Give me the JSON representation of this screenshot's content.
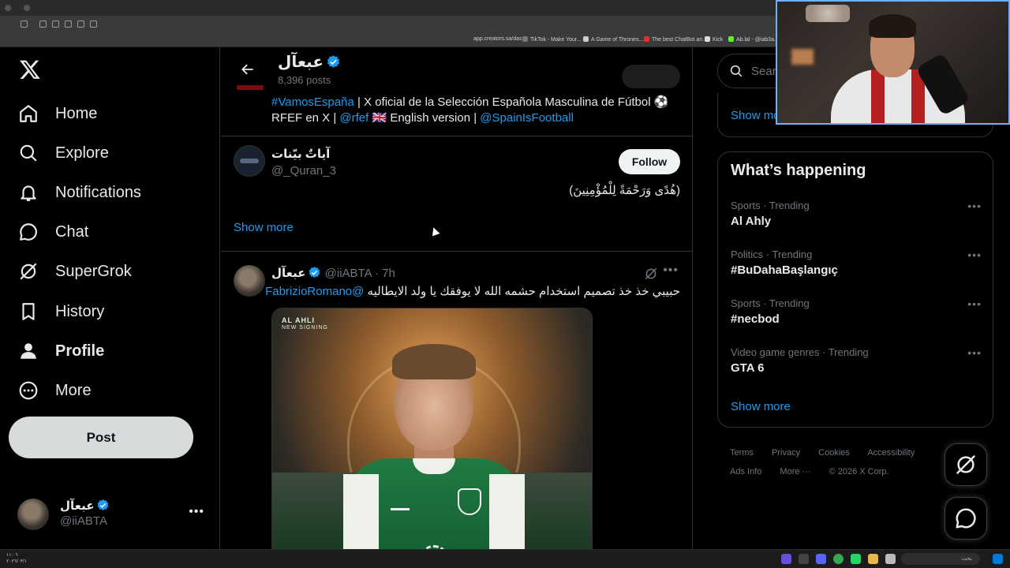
{
  "browser": {
    "bookmarks": [
      {
        "label": "app.creators.sa/das...",
        "color": "#9a9a9a"
      },
      {
        "label": "TikTok - Make Your...",
        "color": "#ffffff"
      },
      {
        "label": "A Game of Thrones...",
        "color": "#cccccc"
      },
      {
        "label": "The best ChatBot an...",
        "color": "#e03030"
      },
      {
        "label": "Kick",
        "color": "#ffffff"
      },
      {
        "label": "Ab.lal - @iab3a...",
        "color": "#53fc18"
      }
    ]
  },
  "nav": {
    "items": [
      {
        "label": "Home",
        "icon": "home-icon"
      },
      {
        "label": "Explore",
        "icon": "search-icon"
      },
      {
        "label": "Notifications",
        "icon": "bell-icon"
      },
      {
        "label": "Chat",
        "icon": "chat-icon"
      },
      {
        "label": "SuperGrok",
        "icon": "grok-icon"
      },
      {
        "label": "History",
        "icon": "bookmark-icon"
      },
      {
        "label": "Profile",
        "icon": "person-icon"
      },
      {
        "label": "More",
        "icon": "more-circle-icon"
      }
    ],
    "post_label": "Post",
    "account": {
      "name": "عبعآل",
      "handle": "@iiABTA"
    }
  },
  "profile": {
    "name": "عبعآل",
    "posts": "8,396 posts"
  },
  "bio": {
    "hashtag": "#VamosEspaña",
    "text1": " | X oficial de la Selección Española Masculina de Fútbol ⚽",
    "text2": "RFEF en X | ",
    "mention1": "@rfef",
    "text3": " 🇬🇧 English version | ",
    "mention2": "@SpainIsFootball"
  },
  "suggestion": {
    "name": "آياتٌ بيّنات",
    "handle": "@_Quran_3",
    "follow_label": "Follow",
    "bio": "(هُدًى وَرَحْمَةً لِلْمُؤْمِنِينَ)",
    "show_more": "Show more"
  },
  "tweet": {
    "name": "عبعآل",
    "handle": "@iiABTA",
    "time": " · 7h",
    "mention": "@FabrizioRomano",
    "text": "حبيبي خذ خذ تصميم استخدام حشمه الله لا يوفقك يا ولد الايطاليه",
    "media_tag1": "AL AHLI",
    "media_tag2": "NEW SIGNING"
  },
  "sidebar": {
    "search_placeholder": "Search",
    "show_more_top": "Show more",
    "trends_title": "What’s happening",
    "trends": [
      {
        "context": "Sports · Trending",
        "topic": "Al Ahly"
      },
      {
        "context": "Politics · Trending",
        "topic": "#BuDahaBaşlangıç"
      },
      {
        "context": "Sports · Trending",
        "topic": "#necbod"
      },
      {
        "context": "Video game genres · Trending",
        "topic": "GTA 6"
      }
    ],
    "show_more_trends": "Show more",
    "footer": [
      "Terms",
      "Privacy",
      "Cookies",
      "Accessibility",
      "Ads Info",
      "More ···",
      "© 2026 X Corp."
    ]
  },
  "taskbar": {
    "time": "١١:٠٦",
    "date": "٢٠٢٦/٠٣/١",
    "search": "بحث"
  },
  "colors": {
    "accent": "#1d9bf0",
    "background": "#000000",
    "border": "#2f3336",
    "muted": "#71767b"
  }
}
